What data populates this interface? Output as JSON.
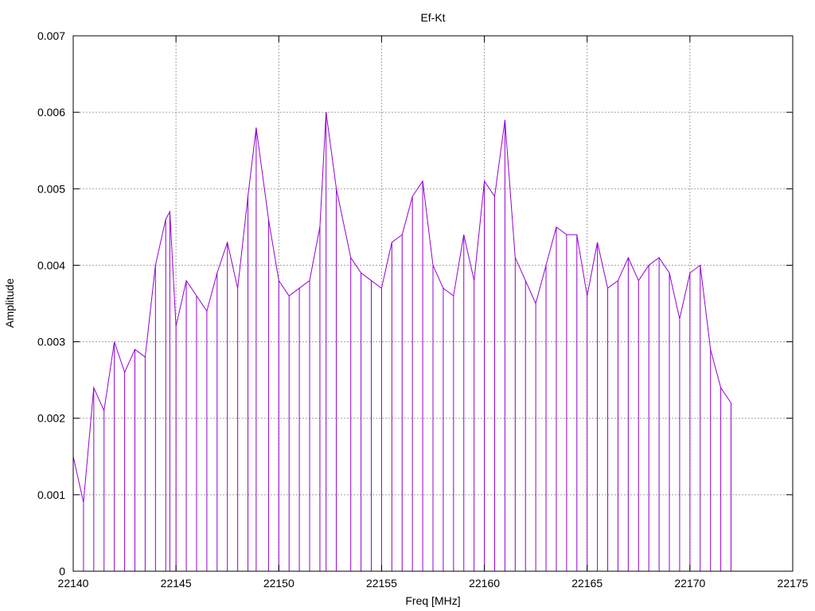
{
  "chart_data": {
    "type": "line",
    "title": "Ef-Kt",
    "xlabel": "Freq [MHz]",
    "ylabel": "Amplitude",
    "xlim": [
      22140,
      22175
    ],
    "ylim": [
      0,
      0.007
    ],
    "x_ticks": [
      "22140",
      "22145",
      "22150",
      "22155",
      "22160",
      "22165",
      "22170",
      "22175"
    ],
    "y_ticks": [
      "0",
      "0.001",
      "0.002",
      "0.003",
      "0.004",
      "0.005",
      "0.006",
      "0.007"
    ],
    "grid": true,
    "legend": "none",
    "series": [
      {
        "color": "#9400D3",
        "style": "impulses",
        "x": [
          22140.0,
          22140.5,
          22141.0,
          22141.5,
          22142.0,
          22142.5,
          22143.0,
          22143.5,
          22144.0,
          22144.5,
          22144.7,
          22145.0,
          22145.5,
          22146.0,
          22146.5,
          22147.0,
          22147.5,
          22148.0,
          22148.5,
          22148.9,
          22149.5,
          22150.0,
          22150.5,
          22151.0,
          22151.5,
          22152.0,
          22152.3,
          22152.8,
          22153.5,
          22154.0,
          22154.5,
          22155.0,
          22155.5,
          22156.0,
          22156.5,
          22157.0,
          22157.5,
          22158.0,
          22158.5,
          22159.0,
          22159.5,
          22160.0,
          22160.5,
          22161.0,
          22161.5,
          22162.0,
          22162.5,
          22163.0,
          22163.5,
          22164.0,
          22164.5,
          22165.0,
          22165.5,
          22166.0,
          22166.5,
          22167.0,
          22167.5,
          22168.0,
          22168.5,
          22169.0,
          22169.5,
          22170.0,
          22170.5,
          22171.0,
          22171.5,
          22172.0
        ],
        "values": [
          0.0015,
          0.0009,
          0.0024,
          0.0021,
          0.003,
          0.0026,
          0.0029,
          0.0028,
          0.004,
          0.0046,
          0.0047,
          0.0032,
          0.0038,
          0.0036,
          0.0034,
          0.0039,
          0.0043,
          0.0037,
          0.0049,
          0.0058,
          0.0046,
          0.0038,
          0.0036,
          0.0037,
          0.0038,
          0.0045,
          0.006,
          0.005,
          0.0041,
          0.0039,
          0.0038,
          0.0037,
          0.0043,
          0.0044,
          0.0049,
          0.0051,
          0.004,
          0.0037,
          0.0036,
          0.0044,
          0.0038,
          0.0051,
          0.0049,
          0.0059,
          0.0041,
          0.0038,
          0.0035,
          0.004,
          0.0045,
          0.0044,
          0.0044,
          0.0036,
          0.0043,
          0.0037,
          0.0038,
          0.0041,
          0.0038,
          0.004,
          0.0041,
          0.0039,
          0.0033,
          0.0039,
          0.004,
          0.0029,
          0.0024,
          0.0022
        ]
      }
    ]
  }
}
